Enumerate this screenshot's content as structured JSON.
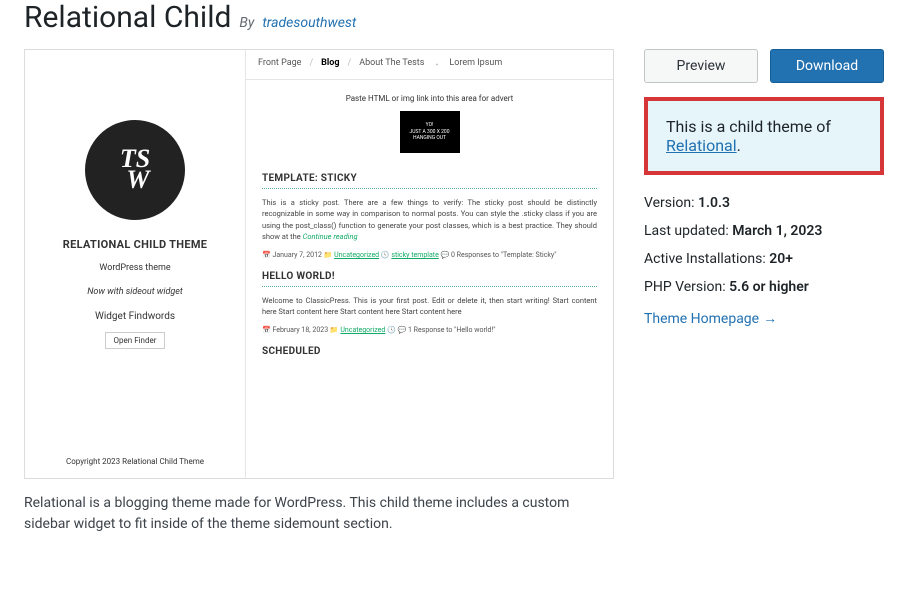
{
  "header": {
    "title": "Relational Child",
    "by": "By",
    "author": "tradesouthwest"
  },
  "actions": {
    "preview": "Preview",
    "download": "Download"
  },
  "notice": {
    "text_prefix": "This is a child theme of ",
    "link": "Relational",
    "suffix": "."
  },
  "meta": {
    "version_label": "Version: ",
    "version": "1.0.3",
    "updated_label": "Last updated: ",
    "updated": "March 1, 2023",
    "installs_label": "Active Installations: ",
    "installs": "20+",
    "php_label": "PHP Version: ",
    "php": "5.6 or higher",
    "homepage": "Theme Homepage"
  },
  "description": "Relational is a blogging theme made for WordPress. This child theme includes a custom sidebar widget to fit inside of the theme sidemount section.",
  "screenshot": {
    "logo": "TS\nW",
    "title": "RELATIONAL CHILD THEME",
    "subtitle": "WordPress theme",
    "tagline": "Now with sideout widget",
    "widget_title": "Widget Findwords",
    "open_finder": "Open Finder",
    "copyright": "Copyright 2023 Relational Child Theme",
    "nav": [
      "Front Page",
      "Blog",
      "About The Tests",
      "Lorem Ipsum"
    ],
    "advert_label": "Paste HTML or img link into this area for advert",
    "advert_box": [
      "YO!",
      "JUST A 300 X 200",
      "HANGING OUT"
    ],
    "post1": {
      "title": "TEMPLATE: STICKY",
      "body": "This is a sticky post. There are a few things to verify: The sticky post should be distinctly recognizable in some way in comparison to normal posts. You can style the .sticky class if you are using the post_class() function to generate your post classes, which is a best practice. They should show at the ",
      "continue": "Continue reading",
      "date": "January 7, 2012",
      "cat": "Uncategorized",
      "tags": "sticky template",
      "resp": "0 Responses to ",
      "resp_title": "\"Template: Sticky\""
    },
    "post2": {
      "title": "HELLO WORLD!",
      "body": "Welcome to ClassicPress. This is your first post. Edit or delete it, then start writing! Start content here Start content here Start content here Start content here",
      "date": "February 18, 2023",
      "cat": "Uncategorized",
      "resp": "1 Response to ",
      "resp_title": "\"Hello world!\""
    },
    "post3_title": "SCHEDULED"
  }
}
